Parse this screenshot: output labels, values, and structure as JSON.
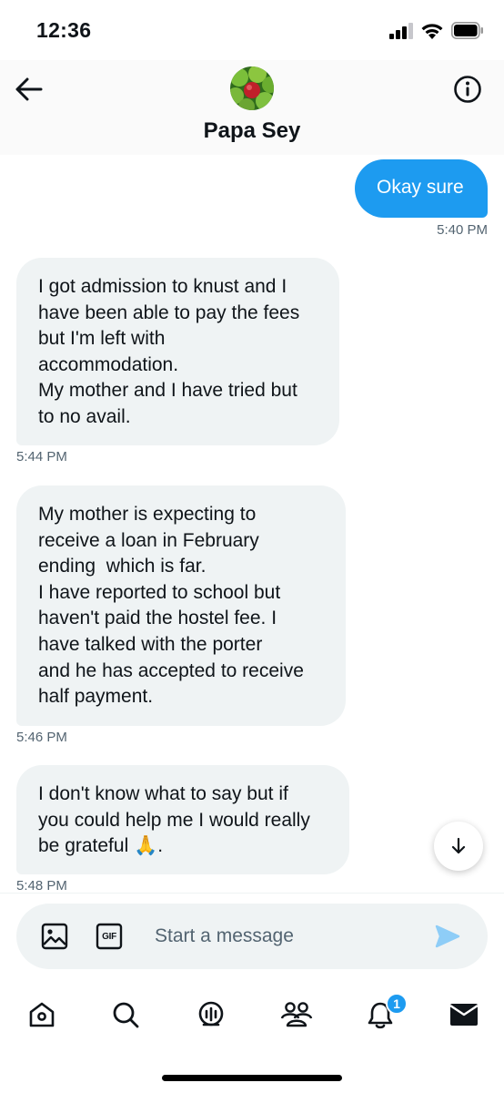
{
  "status_bar": {
    "time": "12:36",
    "icons": [
      "cellular-signal-icon",
      "wifi-icon",
      "battery-icon"
    ]
  },
  "header": {
    "contact_name": "Papa Sey",
    "icons": [
      "back-arrow-icon",
      "info-icon"
    ],
    "avatar": "apples-avatar"
  },
  "messages": [
    {
      "direction": "outgoing",
      "text": "Okay sure",
      "time": "5:40 PM"
    },
    {
      "direction": "incoming",
      "lines": [
        "I got admission to knust and I",
        "have been able to pay the fees",
        "but I'm left with",
        "accommodation.",
        "My mother and I have tried but",
        "to no avail."
      ],
      "time": "5:44 PM"
    },
    {
      "direction": "incoming",
      "lines": [
        "My mother is expecting to",
        "receive a loan in February",
        "ending  which is far.",
        "I have reported to school but",
        "haven't paid the hostel fee. I",
        "have talked with the porter",
        "and he has accepted to receive",
        "half payment."
      ],
      "time": "5:46 PM"
    },
    {
      "direction": "incoming",
      "lines": [
        "I don't know what to say but if",
        "you could help me I would really",
        "be grateful 🙏."
      ],
      "time": "5:48 PM"
    }
  ],
  "composer": {
    "placeholder": "Start a message",
    "gif_label": "GIF",
    "icons": [
      "image-icon",
      "gif-icon",
      "send-icon"
    ]
  },
  "nav": {
    "items": [
      "home",
      "search",
      "spaces",
      "communities",
      "notifications",
      "messages"
    ],
    "notifications_badge": "1"
  },
  "colors": {
    "accent": "#1d9bf0",
    "incoming_bubble": "#eff3f4",
    "text": "#0f1419",
    "secondary_text": "#536471"
  }
}
